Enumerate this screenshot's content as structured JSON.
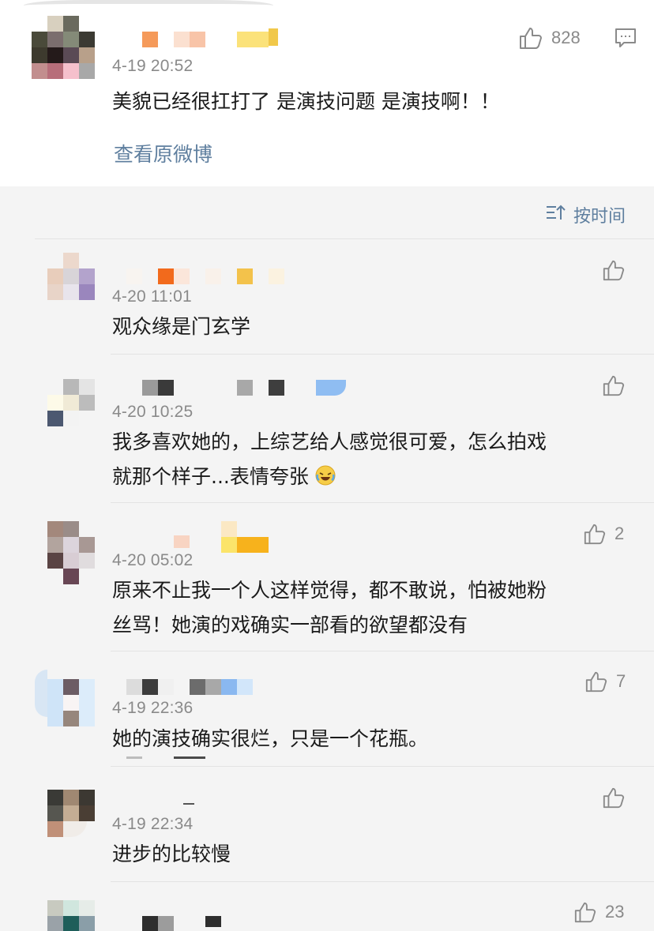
{
  "post": {
    "time": "4-19 20:52",
    "likes": "828",
    "text": "美貌已经很扛打了 是演技问题 是演技啊！！",
    "view_original": "查看原微博"
  },
  "sort": {
    "label": "按时间"
  },
  "comments": [
    {
      "time": "4-20 11:01",
      "text": "观众缘是门玄学",
      "likes": ""
    },
    {
      "time": "4-20 10:25",
      "text_line1": "我多喜欢她的，上综艺给人感觉很可爱，怎么拍戏",
      "text_line2": "就那个样子...表情夸张",
      "likes": ""
    },
    {
      "time": "4-20 05:02",
      "text_line1": "原来不止我一个人这样觉得，都不敢说，怕被她粉",
      "text_line2": "丝骂！她演的戏确实一部看的欲望都没有",
      "likes": "2"
    },
    {
      "time": "4-19 22:36",
      "text": "她的演技确实很烂，只是一个花瓶。",
      "likes": "7"
    },
    {
      "time": "4-19 22:34",
      "text": "进步的比较慢",
      "likes": ""
    },
    {
      "time": "",
      "text": "",
      "likes": "23"
    }
  ],
  "icons": {
    "like": "thumbs-up-icon",
    "comment": "comment-icon",
    "sort": "sort-icon",
    "emoji": "laughing-crying-emoji"
  },
  "colors": {
    "link": "#5f7f9f",
    "meta": "#8a8a8a",
    "background": "#f4f4f4"
  }
}
